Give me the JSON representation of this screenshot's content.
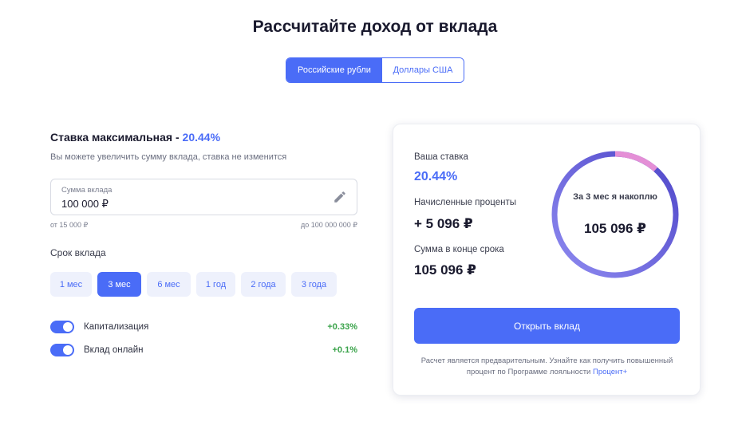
{
  "title": "Рассчитайте доход от вклада",
  "currency": {
    "active": "Российские рубли",
    "inactive": "Доллары США"
  },
  "rate": {
    "prefix": "Ставка максимальная - ",
    "value": "20.44%",
    "subtitle": "Вы можете увеличить сумму вклада, ставка не изменится"
  },
  "amount": {
    "label": "Сумма вклада",
    "value": "100 000 ₽",
    "min": "от 15 000 ₽",
    "max": "до 100 000 000 ₽"
  },
  "term": {
    "label": "Срок вклада",
    "options": [
      "1 мес",
      "3 мес",
      "6 мес",
      "1 год",
      "2 года",
      "3 года"
    ],
    "selected": "3 мес"
  },
  "toggles": [
    {
      "label": "Капитализация",
      "bonus": "+0.33%",
      "on": true
    },
    {
      "label": "Вклад онлайн",
      "bonus": "+0.1%",
      "on": true
    }
  ],
  "result": {
    "rate_label": "Ваша ставка",
    "rate_value": "20.44%",
    "interest_label": "Начисленные проценты",
    "interest_value": "+ 5 096 ₽",
    "total_label": "Сумма в конце срока",
    "total_value": "105 096 ₽",
    "ring_caption": "За 3 мес я накоплю",
    "ring_value": "105 096 ₽",
    "ring_interest_share": 0.0485,
    "open_button": "Открыть вклад",
    "note": "Расчет является предварительным. Узнайте как получить повышенный процент по Программе лояльности",
    "note_link": "Процент+"
  },
  "colors": {
    "accent": "#4a6cf7",
    "positive": "#3aa34a",
    "ring_main": "#6a63e0",
    "ring_interest": "#e48fd6"
  },
  "icons": {
    "edit": "pencil-icon"
  }
}
